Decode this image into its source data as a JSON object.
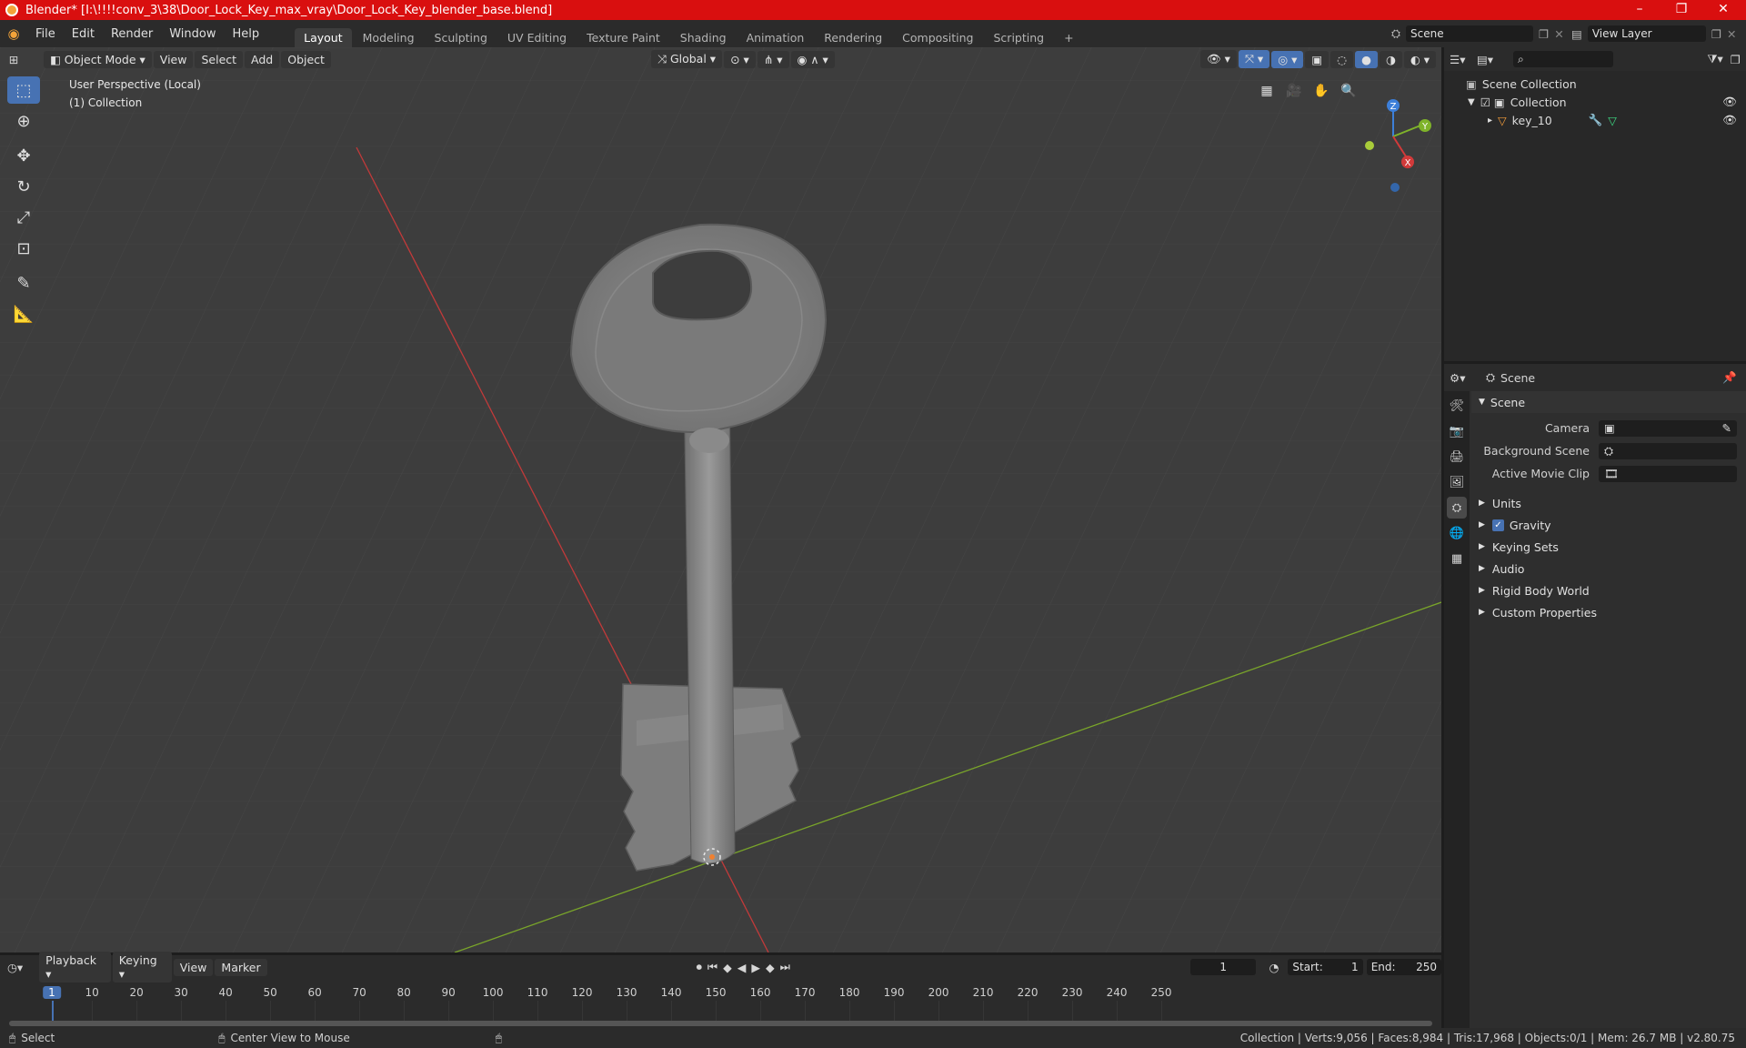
{
  "window": {
    "title": "Blender* [I:\\!!!!conv_3\\38\\Door_Lock_Key_max_vray\\Door_Lock_Key_blender_base.blend]",
    "minimize": "–",
    "maximize": "❐",
    "close": "✕"
  },
  "menu": {
    "items": [
      "File",
      "Edit",
      "Render",
      "Window",
      "Help"
    ],
    "workspaces": [
      "Layout",
      "Modeling",
      "Sculpting",
      "UV Editing",
      "Texture Paint",
      "Shading",
      "Animation",
      "Rendering",
      "Compositing",
      "Scripting"
    ],
    "active_workspace": "Layout",
    "add_workspace": "+",
    "scene": "Scene",
    "view_layer": "View Layer"
  },
  "viewport": {
    "mode": "Object Mode",
    "menus": [
      "View",
      "Select",
      "Add",
      "Object"
    ],
    "orientation": "Global",
    "info_line1": "User Perspective (Local)",
    "info_line2": "(1) Collection",
    "gizmo": {
      "x": "X",
      "y": "Y",
      "z": "Z"
    }
  },
  "outliner": {
    "root": "Scene Collection",
    "collection": "Collection",
    "object": "key_10",
    "search_placeholder": ""
  },
  "properties": {
    "context": "Scene",
    "panel": "Scene",
    "rows": [
      {
        "label": "Camera",
        "value": ""
      },
      {
        "label": "Background Scene",
        "value": ""
      },
      {
        "label": "Active Movie Clip",
        "value": ""
      }
    ],
    "subpanels": [
      "Units",
      "Gravity",
      "Keying Sets",
      "Audio",
      "Rigid Body World",
      "Custom Properties"
    ],
    "gravity_checked": true
  },
  "timeline": {
    "menus": [
      "Playback",
      "Keying",
      "View",
      "Marker"
    ],
    "current_frame": "1",
    "start_label": "Start:",
    "start": "1",
    "end_label": "End:",
    "end": "250",
    "ticks": [
      "1",
      "10",
      "20",
      "30",
      "40",
      "50",
      "60",
      "70",
      "80",
      "90",
      "100",
      "110",
      "120",
      "130",
      "140",
      "150",
      "160",
      "170",
      "180",
      "190",
      "200",
      "210",
      "220",
      "230",
      "240",
      "250"
    ]
  },
  "status": {
    "select": "Select",
    "center": "Center View to Mouse",
    "stats": "Collection | Verts:9,056 | Faces:8,984 | Tris:17,968 | Objects:0/1 | Mem: 26.7 MB | v2.80.75"
  },
  "colors": {
    "title_bar": "#d90f0f",
    "accent": "#4772b3",
    "viewport_bg": "#3d3d3d",
    "x_axis": "#d23a3a",
    "y_axis": "#7fb32a"
  }
}
